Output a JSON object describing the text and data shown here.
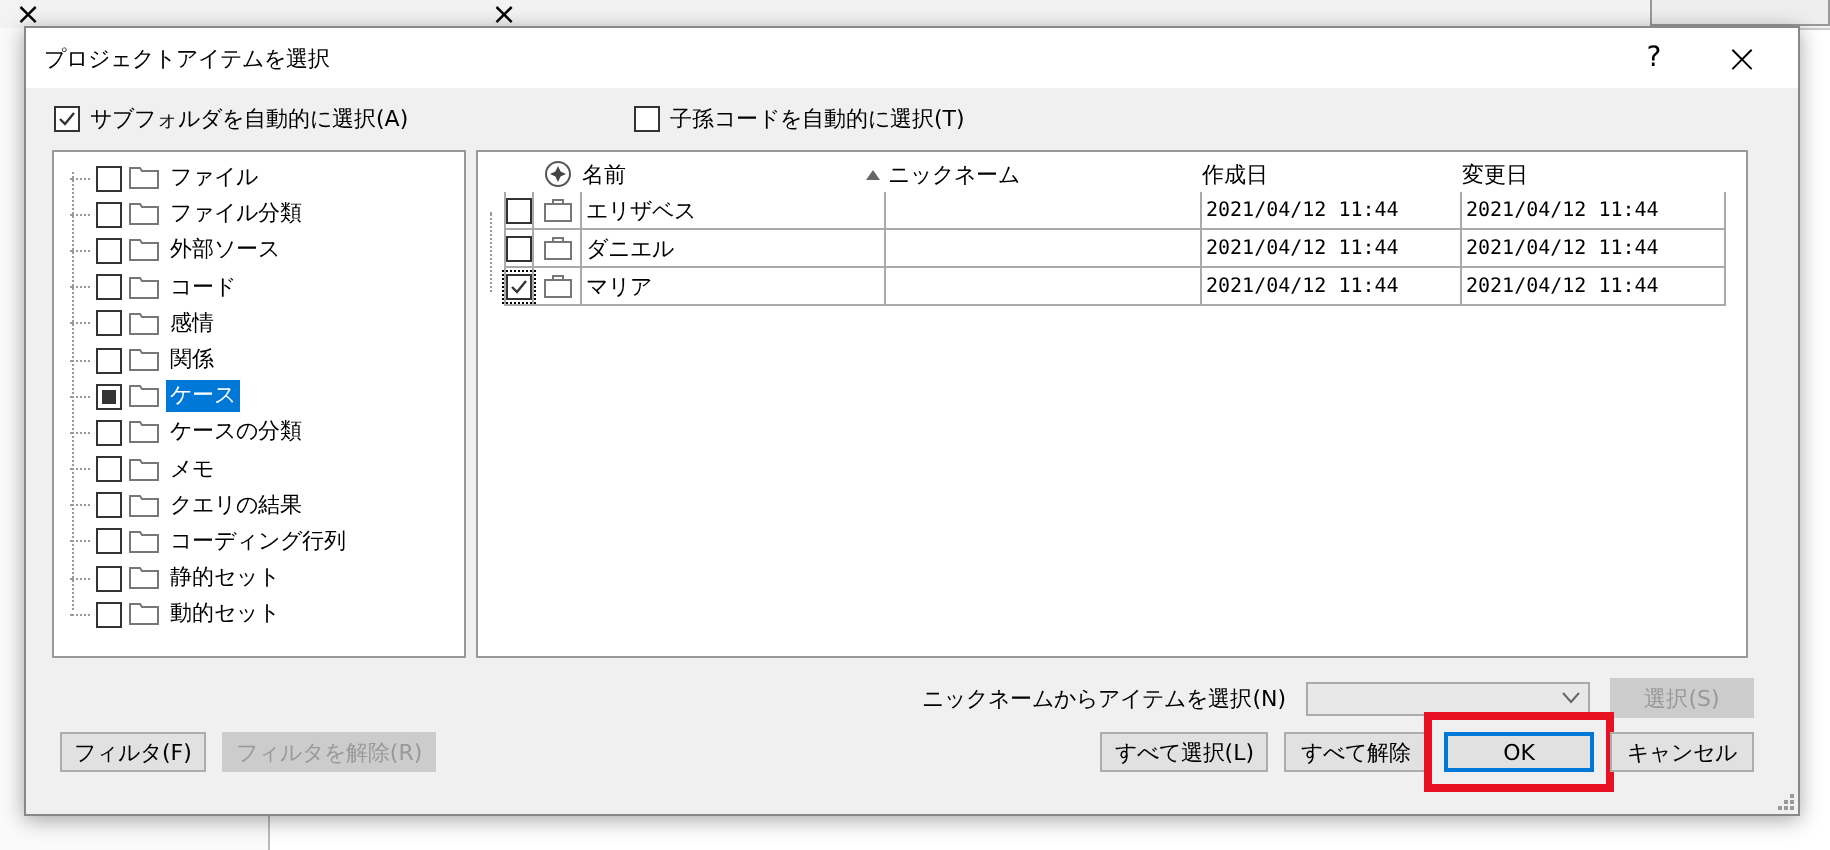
{
  "background": {
    "tab_close": "×",
    "tab_close_2": "×"
  },
  "dialog": {
    "title": "プロジェクトアイテムを選択",
    "help": "?",
    "close": "×",
    "options": [
      {
        "label": "サブフォルダを自動的に選択(A)",
        "checked": true
      },
      {
        "label": "子孫コードを自動的に選択(T)",
        "checked": false
      }
    ],
    "tree": [
      {
        "label": "ファイル",
        "checked": false,
        "selected": false
      },
      {
        "label": "ファイル分類",
        "checked": false,
        "selected": false
      },
      {
        "label": "外部ソース",
        "checked": false,
        "selected": false
      },
      {
        "label": "コード",
        "checked": false,
        "selected": false
      },
      {
        "label": "感情",
        "checked": false,
        "selected": false
      },
      {
        "label": "関係",
        "checked": false,
        "selected": false
      },
      {
        "label": "ケース",
        "checked": true,
        "selected": true
      },
      {
        "label": "ケースの分類",
        "checked": false,
        "selected": false
      },
      {
        "label": "メモ",
        "checked": false,
        "selected": false
      },
      {
        "label": "クエリの結果",
        "checked": false,
        "selected": false
      },
      {
        "label": "コーディング行列",
        "checked": false,
        "selected": false
      },
      {
        "label": "静的セット",
        "checked": false,
        "selected": false
      },
      {
        "label": "動的セット",
        "checked": false,
        "selected": false
      }
    ],
    "table": {
      "columns": [
        "名前",
        "ニックネーム",
        "作成日",
        "変更日"
      ],
      "rows": [
        {
          "name": "エリザベス",
          "nickname": "",
          "created": "2021/04/12 11:44",
          "modified": "2021/04/12 11:44",
          "checked": false
        },
        {
          "name": "ダニエル",
          "nickname": "",
          "created": "2021/04/12 11:44",
          "modified": "2021/04/12 11:44",
          "checked": false
        },
        {
          "name": "マリア",
          "nickname": "",
          "created": "2021/04/12 11:44",
          "modified": "2021/04/12 11:44",
          "checked": true
        }
      ]
    },
    "nickname_label": "ニックネームからアイテムを選択(N)",
    "select_button": {
      "label": "選択(S)",
      "disabled": true
    },
    "left_buttons": [
      {
        "label": "フィルタ(F)",
        "disabled": false
      },
      {
        "label": "フィルタを解除(R)",
        "disabled": true
      }
    ],
    "right_buttons": [
      {
        "label": "すべて選択(L)",
        "default": false,
        "highlighted": false
      },
      {
        "label": "すべて解除",
        "default": false,
        "highlighted": false
      },
      {
        "label": "OK",
        "default": true,
        "highlighted": true
      },
      {
        "label": "キャンセル",
        "default": false,
        "highlighted": false
      }
    ]
  }
}
